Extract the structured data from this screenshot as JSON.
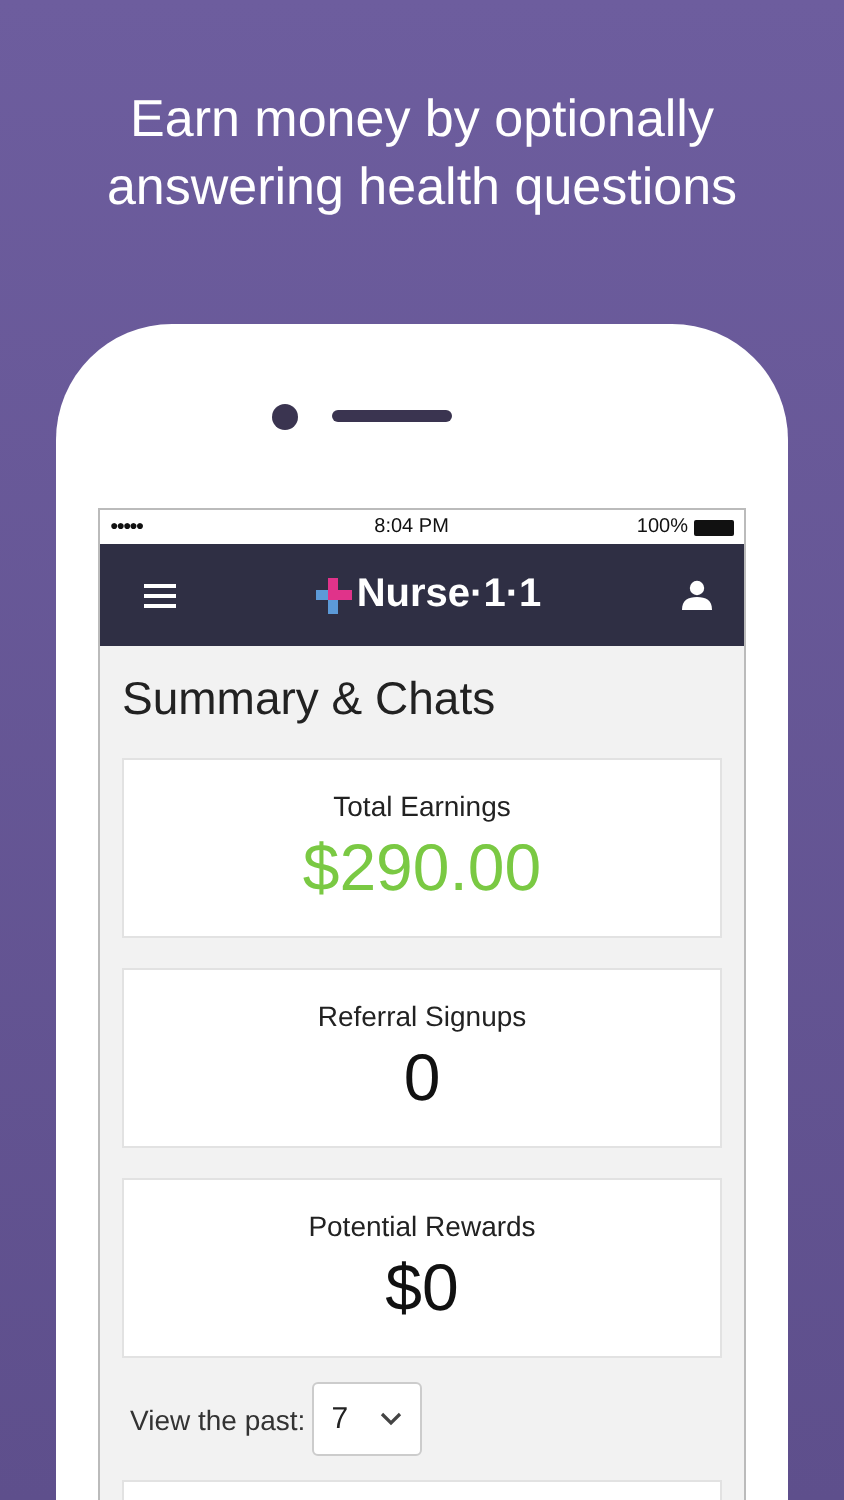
{
  "headline": "Earn money by optionally answering health questions",
  "status_bar": {
    "signal": "●●●●●",
    "time": "8:04 PM",
    "battery": "100%"
  },
  "nav": {
    "logo": "Nurse·1·1"
  },
  "page_title": "Summary & Chats",
  "cards": [
    {
      "label": "Total Earnings",
      "value": "$290.00",
      "kind": "money"
    },
    {
      "label": "Referral Signups",
      "value": "0",
      "kind": "plain"
    },
    {
      "label": "Potential Rewards",
      "value": "$0",
      "kind": "plain"
    }
  ],
  "filter": {
    "label": "View the past:",
    "value": "7"
  }
}
